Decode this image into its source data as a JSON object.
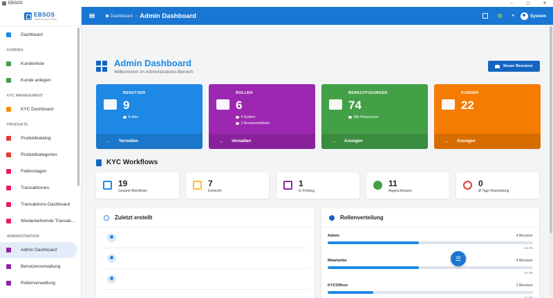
{
  "window": {
    "title": "EBSOS",
    "controls": [
      "–",
      "▢",
      "✕"
    ]
  },
  "logo": {
    "name": "EBSOS",
    "tagline": "COMPLIANCE SYSTEM"
  },
  "sidebar": {
    "items": [
      {
        "type": "item",
        "label": "Dashboard",
        "icon": "grid-icon",
        "color": "#1e88e5"
      },
      {
        "type": "section",
        "label": "KUNDEN"
      },
      {
        "type": "item",
        "label": "Kundenliste",
        "icon": "people-icon",
        "color": "#43a047"
      },
      {
        "type": "item",
        "label": "Kunde anlegen",
        "icon": "person-add-icon",
        "color": "#43a047"
      },
      {
        "type": "section",
        "label": "KYC MANAGEMENT"
      },
      {
        "type": "item",
        "label": "KYC Dashboard",
        "icon": "grid-icon",
        "color": "#fb8c00"
      },
      {
        "type": "section",
        "label": "PRODUKTE"
      },
      {
        "type": "item",
        "label": "Produktkatalog",
        "icon": "catalog-icon",
        "color": "#e53935"
      },
      {
        "type": "item",
        "label": "Produktkategorien",
        "icon": "category-icon",
        "color": "#e53935"
      },
      {
        "type": "item",
        "label": "Feldvorlagen",
        "icon": "template-icon",
        "color": "#e91e63"
      },
      {
        "type": "item",
        "label": "Transaktionen",
        "icon": "transaction-icon",
        "color": "#e91e63"
      },
      {
        "type": "item",
        "label": "Transaktions-Dashboard",
        "icon": "chart-icon",
        "color": "#e91e63"
      },
      {
        "type": "item",
        "label": "Wiederkehrende Transak...",
        "icon": "repeat-icon",
        "color": "#e91e63"
      },
      {
        "type": "section",
        "label": "ADMINISTRATION"
      },
      {
        "type": "item",
        "label": "Admin Dashboard",
        "icon": "admin-icon",
        "color": "#8e24aa",
        "active": true
      },
      {
        "type": "item",
        "label": "Benutzerverwaltung",
        "icon": "people-icon",
        "color": "#8e24aa"
      },
      {
        "type": "item",
        "label": "Rollenverwaltung",
        "icon": "roles-icon",
        "color": "#8e24aa"
      }
    ]
  },
  "appbar": {
    "breadcrumb_root": "Dashboard",
    "breadcrumb_sep": "›",
    "breadcrumb_current": "Admin Dashboard",
    "user_name": "System",
    "status_color": "#43a047"
  },
  "header": {
    "title": "Admin Dashboard",
    "subtitle": "Willkommen im Administrations-Bereich",
    "new_button": "Neuer Benutzer"
  },
  "stats": [
    {
      "label": "BENUTZER",
      "value": "9",
      "meta": [
        "9 aktiv"
      ],
      "action": "Verwalten",
      "color": "#1e88e5",
      "icon": "people-icon"
    },
    {
      "label": "ROLLEN",
      "value": "6",
      "meta": [
        "4 System",
        "2 Benutzerdefiniert"
      ],
      "action": "Verwalten",
      "color": "#9c27b0",
      "icon": "shield-icon"
    },
    {
      "label": "BERECHTIGUNGEN",
      "value": "74",
      "meta": [
        "Alle Ressourcen"
      ],
      "action": "Anzeigen",
      "color": "#43a047",
      "icon": "key-icon"
    },
    {
      "label": "KUNDEN",
      "value": "22",
      "meta": [],
      "action": "Anzeigen",
      "color": "#f57c00",
      "icon": "building-icon"
    }
  ],
  "kyc": {
    "title": "KYC Workflows",
    "cards": [
      {
        "value": "19",
        "label": "Gesamt Workflows",
        "icon": "folder-icon",
        "color": "#1e88e5"
      },
      {
        "value": "7",
        "label": "Entwürfe",
        "icon": "draft-icon",
        "color": "#fbc02d"
      },
      {
        "value": "1",
        "label": "In Prüfung",
        "icon": "review-icon",
        "color": "#8e24aa"
      },
      {
        "value": "11",
        "label": "Abgeschlossen",
        "icon": "check-circle-icon",
        "color": "#43a047"
      },
      {
        "value": "0",
        "label": "Ø Tage Bearbeitung",
        "icon": "clock-icon",
        "color": "#e53935"
      }
    ]
  },
  "recent": {
    "title": "Zuletzt erstellt",
    "rows": 3
  },
  "roles": {
    "title": "Rollenverteilung",
    "items": [
      {
        "name": "Admin",
        "count": "4 Benutzer",
        "percent": "44.4%",
        "fraction": 0.444
      },
      {
        "name": "Mitarbeiter",
        "count": "4 Benutzer",
        "percent": "44.4%",
        "fraction": 0.444
      },
      {
        "name": "KYCOfficer",
        "count": "2 Benutzer",
        "percent": "22.2%",
        "fraction": 0.222
      }
    ]
  }
}
